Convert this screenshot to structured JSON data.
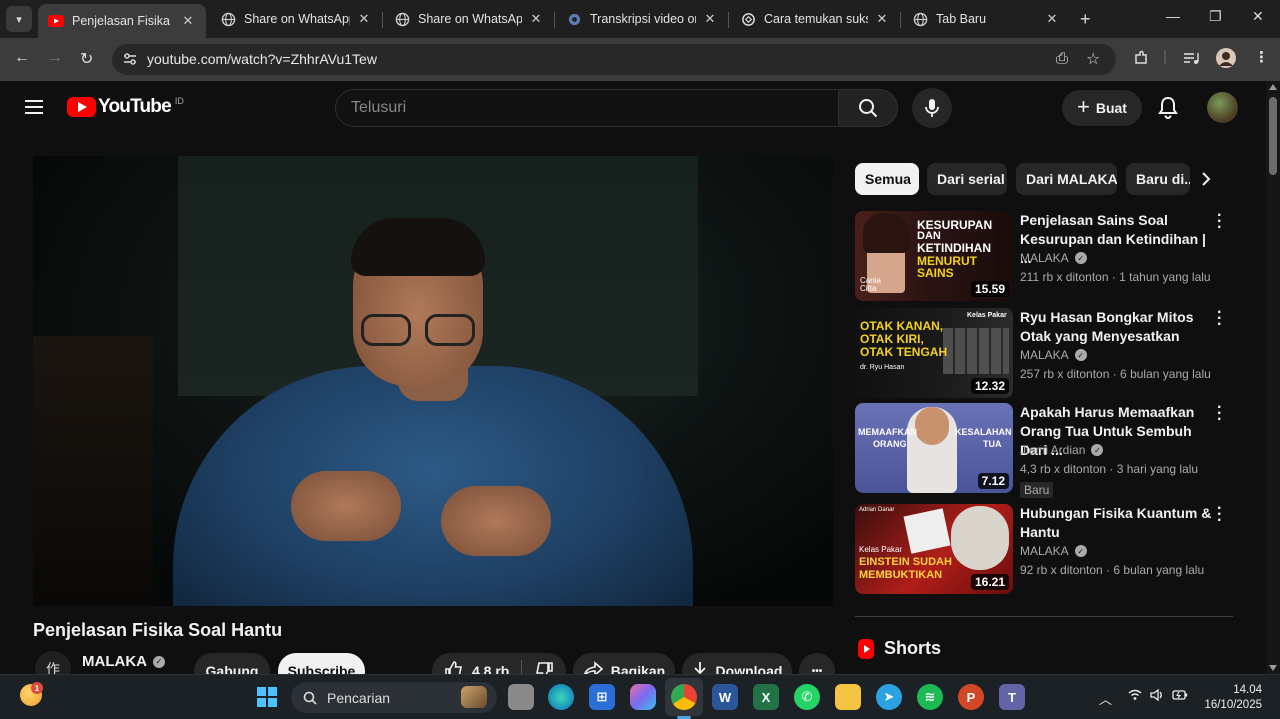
{
  "browser": {
    "tabs": [
      {
        "title": "Penjelasan Fisika Soal",
        "favicon": "youtube-icon",
        "active": true
      },
      {
        "title": "Share on WhatsApp",
        "favicon": "globe-icon",
        "active": false
      },
      {
        "title": "Share on WhatsApp",
        "favicon": "globe-icon",
        "active": false
      },
      {
        "title": "Transkripsi video onli",
        "favicon": "gear-icon",
        "active": false
      },
      {
        "title": "Cara temukan sukses",
        "favicon": "openai-icon",
        "active": false
      },
      {
        "title": "Tab Baru",
        "favicon": "globe-icon",
        "active": false
      }
    ],
    "url": "youtube.com/watch?v=ZhhrAVu1Tew"
  },
  "youtube": {
    "logo_text": "YouTube",
    "country_code": "ID",
    "search_placeholder": "Telusuri",
    "create_label": "Buat",
    "video": {
      "title": "Penjelasan Fisika Soal Hantu",
      "channel": "MALAKA",
      "channel_avatar_text": "作",
      "join_label": "Gabung",
      "subscribe_label": "Subscribe",
      "likes": "4,8 rb",
      "share_label": "Bagikan",
      "download_label": "Download",
      "more_label": "•••"
    },
    "chips": [
      "Semua",
      "Dari serial",
      "Dari MALAKA",
      "Baru di..."
    ],
    "recommendations": [
      {
        "title": "Penjelasan Sains Soal Kesurupan dan Ketindihan | ...",
        "channel": "MALAKA",
        "meta": "211 rb x ditonton · 1 tahun yang lalu",
        "duration": "15.59",
        "thumb_text": [
          "KESURUPAN",
          "DAN",
          "KETINDIHAN",
          "MENURUT",
          "SAINS"
        ],
        "thumb_caption": "Cania Citta"
      },
      {
        "title": "Ryu Hasan Bongkar Mitos Otak yang Menyesatkan",
        "channel": "MALAKA",
        "meta": "257 rb x ditonton · 6 bulan yang lalu",
        "duration": "12.32",
        "thumb_text": [
          "OTAK KANAN,",
          "OTAK KIRI,",
          "OTAK TENGAH"
        ],
        "thumb_caption": "dr. Ryu Hasan",
        "thumb_tag": "Kelas Pakar"
      },
      {
        "title": "Apakah Harus Memaafkan Orang Tua Untuk Sembuh Dari ...",
        "channel": "Jiemi Ardian",
        "meta": "4,3 rb x ditonton · 3 hari yang lalu",
        "duration": "7.12",
        "badge": "Baru",
        "thumb_text": [
          "MEMAAFKAN",
          "ORANG",
          "KESALAHAN",
          "TUA"
        ]
      },
      {
        "title": "Hubungan Fisika Kuantum & Hantu",
        "channel": "MALAKA",
        "meta": "92 rb x ditonton · 6 bulan yang lalu",
        "duration": "16.21",
        "thumb_text": [
          "Kelas Pakar",
          "EINSTEIN SUDAH",
          "MEMBUKTIKAN"
        ],
        "thumb_caption": "Adrian Danar"
      }
    ],
    "shorts_label": "Shorts"
  },
  "taskbar": {
    "search_placeholder": "Pencarian",
    "notification_count": "1",
    "time": "14.04",
    "date": "16/10/2025"
  },
  "colors": {
    "youtube_red": "#ff0000",
    "background": "#0f0f0f",
    "chip_active": "#f1f1f1"
  }
}
